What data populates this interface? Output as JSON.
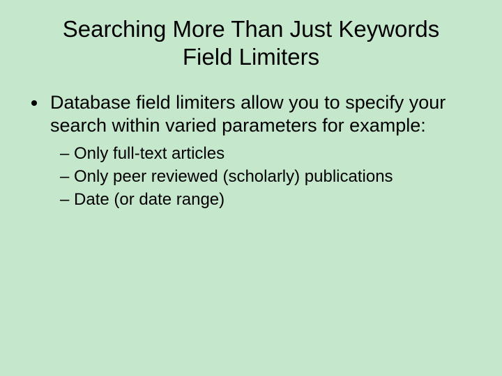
{
  "title_line1": "Searching More Than Just Keywords",
  "title_line2": "Field Limiters",
  "bullet_main": "Database field limiters allow you to specify your search within varied parameters for example:",
  "sub_items": {
    "a": "– Only full-text articles",
    "b": "– Only peer reviewed (scholarly) publications",
    "c": "– Date (or date range)"
  }
}
